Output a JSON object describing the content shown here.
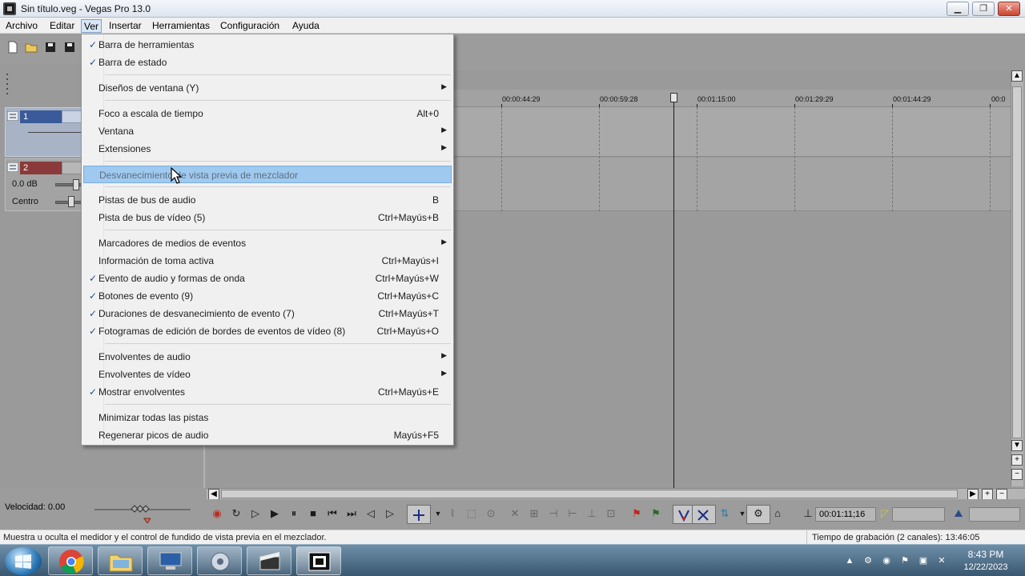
{
  "window": {
    "title": "Sin título.veg - Vegas Pro 13.0",
    "min": "▁",
    "max": "❐",
    "close": "✕"
  },
  "menubar": [
    {
      "label": "Archivo"
    },
    {
      "label": "Editar"
    },
    {
      "label": "Ver"
    },
    {
      "label": "Insertar"
    },
    {
      "label": "Herramientas"
    },
    {
      "label": "Configuración"
    },
    {
      "label": "Ayuda"
    }
  ],
  "tracks": {
    "track1": {
      "num": "1"
    },
    "track2": {
      "num": "2",
      "volume": "0.0 dB",
      "pan": "Centro"
    }
  },
  "ruler": {
    "ticks": [
      "00:00:44:29",
      "00:00:59:28",
      "00:01:15:00",
      "00:01:29:29",
      "00:01:44:29",
      "00:0"
    ]
  },
  "transport": {
    "speed": "Velocidad: 0.00",
    "timecode": "00:01:11;16"
  },
  "status": {
    "message": "Muestra u oculta el medidor y el control de fundido de vista previa en el mezclador.",
    "record_time": "Tiempo de grabación (2 canales): 13:46:05"
  },
  "taskbar": {
    "time": "8:43 PM",
    "date": "12/22/2023"
  },
  "ver_menu": {
    "items": [
      {
        "label": "Barra de herramientas",
        "shortcut": "",
        "checked": true,
        "submenu": false
      },
      {
        "label": "Barra de estado",
        "shortcut": "",
        "checked": true,
        "submenu": false
      },
      {
        "label": "Diseños de ventana (Y)",
        "shortcut": "",
        "checked": false,
        "submenu": true
      },
      {
        "label": "Foco a escala de tiempo",
        "shortcut": "Alt+0",
        "checked": false,
        "submenu": false
      },
      {
        "label": "Ventana",
        "shortcut": "",
        "checked": false,
        "submenu": true
      },
      {
        "label": "Extensiones",
        "shortcut": "",
        "checked": false,
        "submenu": true
      },
      {
        "label": "Desvanecimiento de vista previa de mezclador",
        "shortcut": "",
        "checked": false,
        "submenu": false,
        "highlighted": true
      },
      {
        "label": "Pistas de bus de audio",
        "shortcut": "B",
        "checked": false,
        "submenu": false
      },
      {
        "label": "Pista de bus de vídeo (5)",
        "shortcut": "Ctrl+Mayús+B",
        "checked": false,
        "submenu": false
      },
      {
        "label": "Marcadores de medios de eventos",
        "shortcut": "",
        "checked": false,
        "submenu": true
      },
      {
        "label": "Información de toma activa",
        "shortcut": "Ctrl+Mayús+I",
        "checked": false,
        "submenu": false
      },
      {
        "label": "Evento de audio y formas de onda",
        "shortcut": "Ctrl+Mayús+W",
        "checked": true,
        "submenu": false
      },
      {
        "label": "Botones de evento (9)",
        "shortcut": "Ctrl+Mayús+C",
        "checked": true,
        "submenu": false
      },
      {
        "label": "Duraciones de desvanecimiento de evento (7)",
        "shortcut": "Ctrl+Mayús+T",
        "checked": true,
        "submenu": false
      },
      {
        "label": "Fotogramas de edición de bordes de eventos de vídeo (8)",
        "shortcut": "Ctrl+Mayús+O",
        "checked": true,
        "submenu": false
      },
      {
        "label": "Envolventes de audio",
        "shortcut": "",
        "checked": false,
        "submenu": true
      },
      {
        "label": "Envolventes de vídeo",
        "shortcut": "",
        "checked": false,
        "submenu": true
      },
      {
        "label": "Mostrar envolventes",
        "shortcut": "Ctrl+Mayús+E",
        "checked": true,
        "submenu": false
      },
      {
        "label": "Minimizar todas las pistas",
        "shortcut": "",
        "checked": false,
        "submenu": false
      },
      {
        "label": "Regenerar picos de audio",
        "shortcut": "Mayús+F5",
        "checked": false,
        "submenu": false
      }
    ],
    "check_glyph": "✓",
    "arrow_glyph": "▶"
  },
  "colors": {
    "highlight": "#9fc9ef",
    "track1": "#3a5a99",
    "track2": "#8a3a3a"
  }
}
